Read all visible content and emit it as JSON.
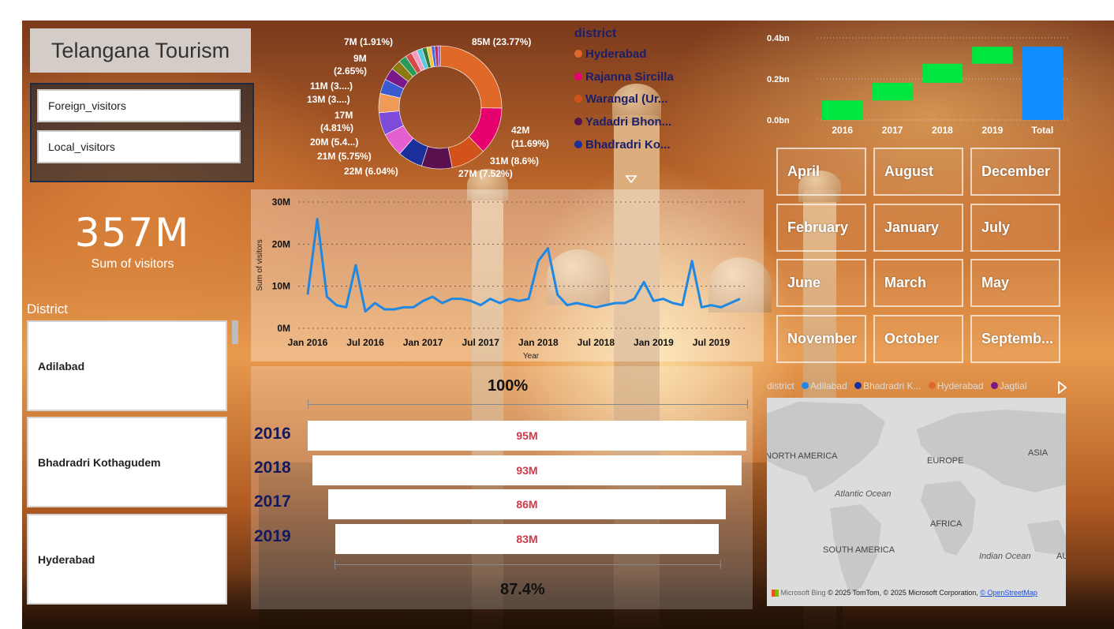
{
  "title": "Telangana Tourism",
  "toggles": [
    "Foreign_visitors",
    "Local_visitors"
  ],
  "kpi": {
    "value": "357M",
    "label": "Sum of visitors"
  },
  "district_slicer": {
    "title": "District",
    "items": [
      "Adilabad",
      "Bhadradri Kothagudem",
      "Hyderabad"
    ]
  },
  "donut": {
    "legend_title": "district",
    "legend": [
      {
        "label": "Hyderabad",
        "color": "#e0692a"
      },
      {
        "label": "Rajanna Sircilla",
        "color": "#e5006e"
      },
      {
        "label": "Warangal (Ur...",
        "color": "#d2521a"
      },
      {
        "label": "Yadadri Bhon...",
        "color": "#5a0f4e"
      },
      {
        "label": "Bhadradri Ko...",
        "color": "#1a2f9a"
      }
    ],
    "labels": [
      "85M (23.77%)",
      "42M",
      "(11.69%)",
      "31M (8.6%)",
      "27M (7.52%)",
      "22M (6.04%)",
      "21M (5.75%)",
      "20M (5.4...)",
      "17M",
      "(4.81%)",
      "13M (3....)",
      "11M (3....)",
      "9M",
      "(2.65%)",
      "7M (1.91%)"
    ],
    "slices": [
      {
        "value": 85,
        "color": "#e0692a"
      },
      {
        "value": 42,
        "color": "#e5006e"
      },
      {
        "value": 31,
        "color": "#d2521a"
      },
      {
        "value": 27,
        "color": "#5a0f4e"
      },
      {
        "value": 22,
        "color": "#1a2f9a"
      },
      {
        "value": 21,
        "color": "#e45fd0"
      },
      {
        "value": 20,
        "color": "#7d4bd8"
      },
      {
        "value": 17,
        "color": "#f09a5a"
      },
      {
        "value": 13,
        "color": "#3a5bd0"
      },
      {
        "value": 11,
        "color": "#7a1a8a"
      },
      {
        "value": 9,
        "color": "#8a7a10"
      },
      {
        "value": 7,
        "color": "#2a9a5a"
      },
      {
        "value": 6,
        "color": "#d84a4a"
      },
      {
        "value": 5,
        "color": "#f59ac0"
      },
      {
        "value": 5,
        "color": "#5ac8e0"
      },
      {
        "value": 4,
        "color": "#2e7d32"
      },
      {
        "value": 4,
        "color": "#f2c14e"
      },
      {
        "value": 3,
        "color": "#4a6ae0"
      },
      {
        "value": 3,
        "color": "#b03060"
      },
      {
        "value": 2,
        "color": "#6a5acd"
      }
    ]
  },
  "chart_data": [
    {
      "type": "line",
      "xlabel": "Year",
      "ylabel": "Sum of visitors",
      "x_ticks": [
        "Jan 2016",
        "Jul 2016",
        "Jan 2017",
        "Jul 2017",
        "Jan 2018",
        "Jul 2018",
        "Jan 2019",
        "Jul 2019"
      ],
      "y_ticks": [
        "0M",
        "10M",
        "20M",
        "30M"
      ],
      "ylim": [
        0,
        30
      ],
      "color": "#1e88e5",
      "values": [
        8,
        26,
        7.5,
        5.5,
        5,
        15,
        4,
        6,
        4.5,
        4.5,
        5,
        5,
        6.5,
        7.5,
        6,
        7,
        7,
        6.5,
        5.5,
        7,
        6,
        7,
        6.5,
        7,
        16,
        19,
        8,
        5.5,
        6,
        5.5,
        5,
        5.5,
        6,
        6,
        7,
        11,
        6.5,
        7,
        6,
        5.5,
        16,
        5,
        5.5,
        5,
        6,
        7
      ]
    },
    {
      "type": "bar",
      "subtype": "waterfall",
      "categories": [
        "2016",
        "2017",
        "2018",
        "2019",
        "Total"
      ],
      "values": [
        0.095,
        0.086,
        0.093,
        0.083,
        0.357
      ],
      "y_ticks": [
        "0.0bn",
        "0.2bn",
        "0.4bn"
      ],
      "ylim": [
        0,
        0.4
      ],
      "colors": {
        "increase": "#00e640",
        "total": "#118dff"
      }
    },
    {
      "type": "bar",
      "subtype": "funnel",
      "categories": [
        "2016",
        "2018",
        "2017",
        "2019"
      ],
      "values": [
        95,
        93,
        86,
        83
      ],
      "labels": [
        "95M",
        "93M",
        "86M",
        "83M"
      ],
      "top_pct": "100%",
      "bottom_pct": "87.4%"
    }
  ],
  "months": [
    "April",
    "August",
    "December",
    "February",
    "January",
    "July",
    "June",
    "March",
    "May",
    "November",
    "October",
    "Septemb..."
  ],
  "map": {
    "legend_title": "district",
    "legend": [
      {
        "label": "Adilabad",
        "color": "#1e88e5"
      },
      {
        "label": "Bhadradri K...",
        "color": "#1a2f9a"
      },
      {
        "label": "Hyderabad",
        "color": "#e0692a"
      },
      {
        "label": "Jagtial",
        "color": "#7a1a8a"
      }
    ],
    "labels": {
      "na": "NORTH AMERICA",
      "eu": "EUROPE",
      "asia": "ASIA",
      "atl": "Atlantic Ocean",
      "af": "AFRICA",
      "sa": "SOUTH AMERICA",
      "ind": "Indian Ocean",
      "au": "AU"
    },
    "attribution": {
      "bing": "Microsoft Bing",
      "text": "© 2025 TomTom, © 2025 Microsoft Corporation, ",
      "link": "© OpenStreetMap"
    }
  }
}
